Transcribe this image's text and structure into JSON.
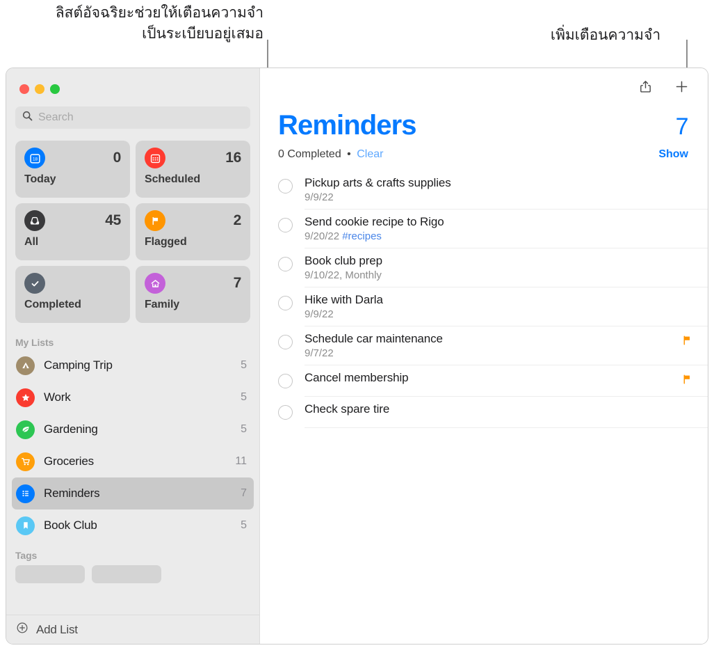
{
  "callouts": {
    "left": "ลิสต์อัจฉริยะช่วยให้เตือนความจำ\nเป็นระเบียบอยู่เสมอ",
    "right": "เพิ่มเตือนความจำ"
  },
  "window": {
    "traffic_lights": [
      {
        "name": "close",
        "color": "#ff5f57"
      },
      {
        "name": "minimize",
        "color": "#febc2e"
      },
      {
        "name": "zoom",
        "color": "#28c840"
      }
    ]
  },
  "sidebar": {
    "search": {
      "placeholder": "Search",
      "value": "",
      "icon": "search-icon"
    },
    "smart_lists": [
      {
        "label": "Today",
        "count": "0",
        "icon": "calendar-day-icon",
        "color": "#007aff"
      },
      {
        "label": "Scheduled",
        "count": "16",
        "icon": "calendar-icon",
        "color": "#ff3b30"
      },
      {
        "label": "All",
        "count": "45",
        "icon": "inbox-tray-icon",
        "color": "#3a3a3c"
      },
      {
        "label": "Flagged",
        "count": "2",
        "icon": "flag-icon",
        "color": "#ff9500"
      },
      {
        "label": "Completed",
        "count": "",
        "icon": "checkmark-icon",
        "color": "#5a6470"
      },
      {
        "label": "Family",
        "count": "7",
        "icon": "house-icon",
        "color": "#c361d9"
      }
    ],
    "my_lists_header": "My Lists",
    "my_lists": [
      {
        "label": "Camping Trip",
        "count": "5",
        "icon": "tent-icon",
        "color": "#a08c6a"
      },
      {
        "label": "Work",
        "count": "5",
        "icon": "star-icon",
        "color": "#fa3b2f"
      },
      {
        "label": "Gardening",
        "count": "5",
        "icon": "leaf-icon",
        "color": "#2dc653"
      },
      {
        "label": "Groceries",
        "count": "11",
        "icon": "cart-icon",
        "color": "#ff9f0a"
      },
      {
        "label": "Reminders",
        "count": "7",
        "icon": "list-bullet-icon",
        "color": "#007aff",
        "selected": true
      },
      {
        "label": "Book Club",
        "count": "5",
        "icon": "bookmark-icon",
        "color": "#5ac8f5"
      }
    ],
    "tags_header": "Tags",
    "tag_chips": [
      "",
      ""
    ],
    "add_list": {
      "label": "Add List",
      "icon": "plus-circle-icon"
    }
  },
  "content": {
    "toolbar": [
      {
        "name": "share-button",
        "icon": "share-icon"
      },
      {
        "name": "add-reminder-button",
        "icon": "plus-icon"
      }
    ],
    "title": "Reminders",
    "total": "7",
    "completed_text": "0 Completed",
    "separator": "•",
    "clear_label": "Clear",
    "show_label": "Show",
    "accent_color": "#067aff",
    "flag_color": "#ff9500",
    "reminders": [
      {
        "title": "Pickup arts & crafts supplies",
        "date": "9/9/22",
        "extra": "",
        "tag": "",
        "flagged": false
      },
      {
        "title": "Send cookie recipe to Rigo",
        "date": "9/20/22",
        "extra": "",
        "tag": "#recipes",
        "flagged": false
      },
      {
        "title": "Book club prep",
        "date": "9/10/22",
        "extra": ", Monthly",
        "tag": "",
        "flagged": false
      },
      {
        "title": "Hike with Darla",
        "date": "9/9/22",
        "extra": "",
        "tag": "",
        "flagged": false
      },
      {
        "title": "Schedule car maintenance",
        "date": "9/7/22",
        "extra": "",
        "tag": "",
        "flagged": true
      },
      {
        "title": "Cancel membership",
        "date": "",
        "extra": "",
        "tag": "",
        "flagged": true
      },
      {
        "title": "Check spare tire",
        "date": "",
        "extra": "",
        "tag": "",
        "flagged": false
      }
    ]
  }
}
